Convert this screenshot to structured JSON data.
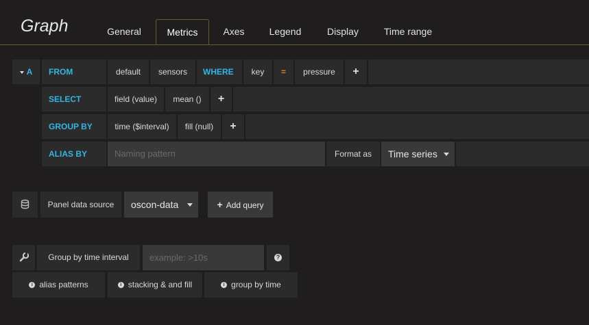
{
  "header": {
    "title": "Graph",
    "tabs": [
      "General",
      "Metrics",
      "Axes",
      "Legend",
      "Display",
      "Time range"
    ],
    "active_tab": "Metrics"
  },
  "query": {
    "ref_id": "A",
    "from": {
      "keyword": "FROM",
      "policy": "default",
      "measurement": "sensors",
      "where_keyword": "WHERE",
      "tag_key": "key",
      "operator": "=",
      "tag_value": "pressure",
      "add": "+"
    },
    "select": {
      "keyword": "SELECT",
      "field": "field (value)",
      "func": "mean ()",
      "add": "+"
    },
    "group_by": {
      "keyword": "GROUP BY",
      "time": "time ($interval)",
      "fill": "fill (null)",
      "add": "+"
    },
    "alias_by": {
      "keyword": "ALIAS BY",
      "placeholder": "Naming pattern",
      "format_label": "Format as",
      "format_value": "Time series"
    }
  },
  "datasource": {
    "label": "Panel data source",
    "value": "oscon-data",
    "add_query": "Add query",
    "add_icon": "+"
  },
  "options": {
    "group_by_interval_label": "Group by time interval",
    "interval_placeholder": "example: >10s",
    "help_icon": "?"
  },
  "help_links": [
    "alias patterns",
    "stacking & and fill",
    "group by time"
  ]
}
